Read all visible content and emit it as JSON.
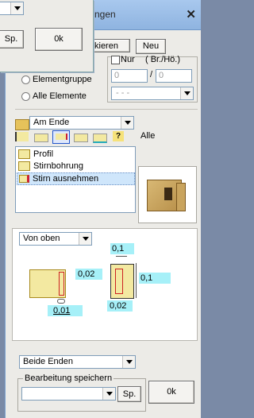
{
  "titlebar": {
    "title": "ngen",
    "close": "✕"
  },
  "popup": {
    "sp_label": "Sp.",
    "ok_label": "0k"
  },
  "top_buttons": {
    "markieren": "kieren",
    "neu": "Neu"
  },
  "filter": {
    "nur_label": "Nur",
    "br_ho_label": "( Br./Hö.)",
    "slash": "/",
    "value1": "0",
    "value2": "0",
    "dash_select": "- - -",
    "radio_elementgruppe": "Elementgruppe",
    "radio_alle_elemente": "Alle Elemente"
  },
  "position_select": {
    "value": "Am Ende"
  },
  "toolbar": {
    "alle_label": "Alle"
  },
  "operations": {
    "items": [
      {
        "label": "Profil"
      },
      {
        "label": "Stirnbohrung"
      },
      {
        "label": "Stirn ausnehmen"
      }
    ],
    "selected_index": 2
  },
  "params": {
    "direction_select": "Von oben",
    "dim_top": "0,1",
    "dim_left_mid": "0,02",
    "dim_right": "0,1",
    "dim_left_bottom": "0,01",
    "dim_bottom": "0,02"
  },
  "ends_select": {
    "value": "Beide Enden"
  },
  "save": {
    "group_label": "Bearbeitung speichern",
    "sp_label": "Sp.",
    "ok_label": "0k"
  },
  "colors": {
    "title_bar": "#a8c8ee",
    "selection": "#cfe6fb",
    "highlight_cyan": "#a6f0f8",
    "wood": "#f3e9a1"
  }
}
